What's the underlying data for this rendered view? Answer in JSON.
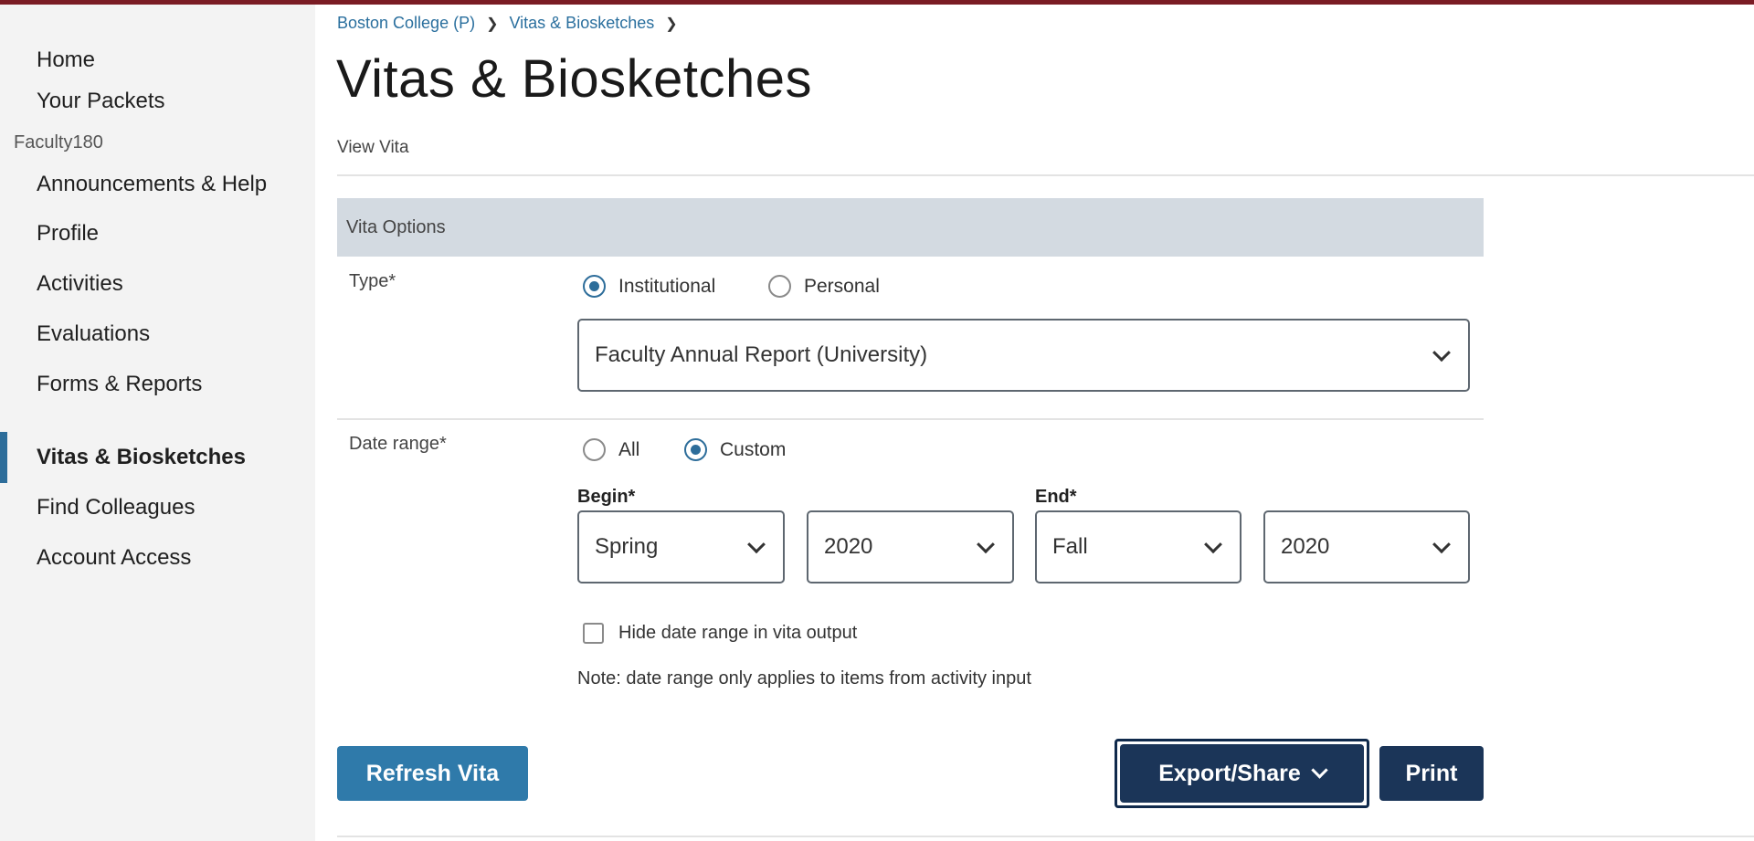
{
  "sidebar": {
    "items_top": [
      "Home",
      "Your Packets"
    ],
    "group_label": "Faculty180",
    "items": [
      "Announcements & Help",
      "Profile",
      "Activities",
      "Evaluations",
      "Forms & Reports",
      "Vitas & Biosketches",
      "Find Colleagues",
      "Account Access"
    ],
    "active_item": "Vitas & Biosketches"
  },
  "breadcrumb": [
    "Boston College (P)",
    "Vitas & Biosketches"
  ],
  "page": {
    "title": "Vitas & Biosketches",
    "subnav": "View Vita"
  },
  "vita_options": {
    "header": "Vita Options",
    "type": {
      "label": "Type*",
      "options": [
        "Institutional",
        "Personal"
      ],
      "selected": "Institutional",
      "template_select": "Faculty Annual Report (University)"
    },
    "date_range": {
      "label": "Date range*",
      "options": [
        "All",
        "Custom"
      ],
      "selected": "Custom",
      "begin_label": "Begin*",
      "end_label": "End*",
      "begin_term": "Spring",
      "begin_year": "2020",
      "end_term": "Fall",
      "end_year": "2020"
    },
    "hide_date_range": {
      "label": "Hide date range in vita output",
      "checked": false
    },
    "note": "Note: date range only applies to items from activity input"
  },
  "actions": {
    "refresh": "Refresh Vita",
    "export": "Export/Share",
    "print": "Print"
  },
  "colors": {
    "top_bar": "#7a1c24",
    "accent": "#2d6d9a",
    "dark_button": "#1b3558",
    "panel_header": "#d3dae1"
  }
}
